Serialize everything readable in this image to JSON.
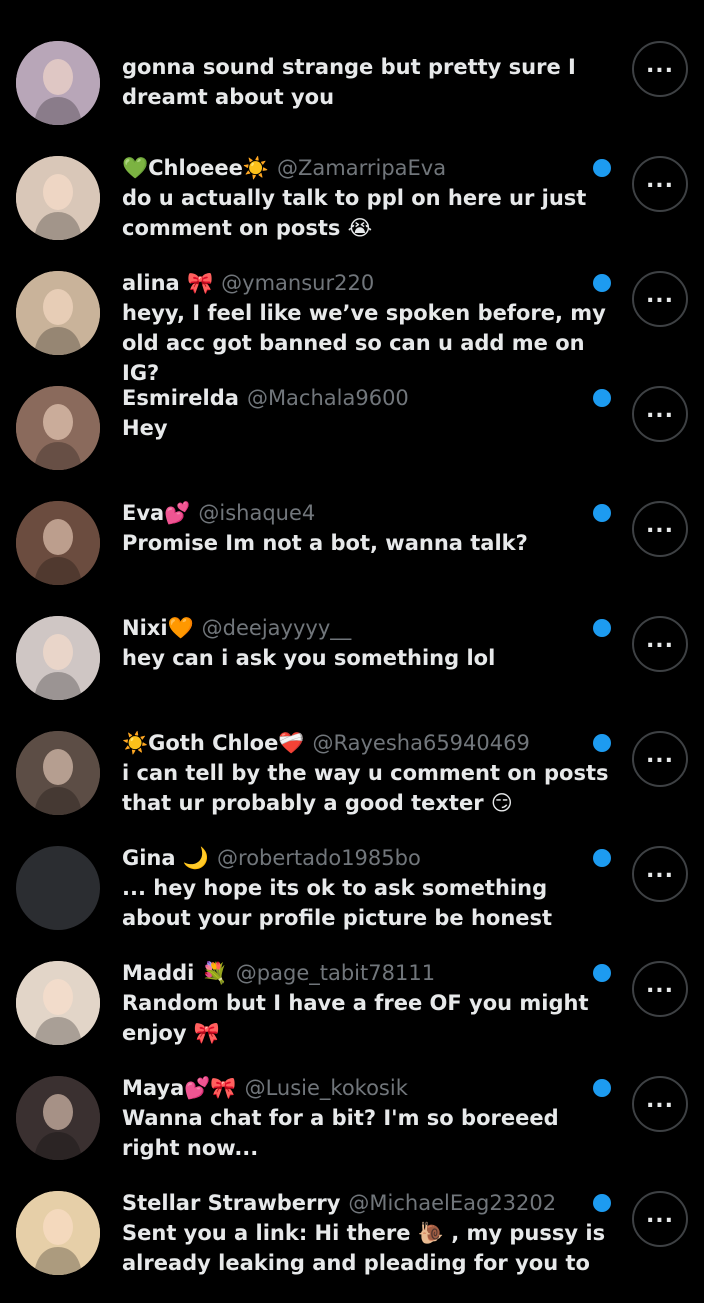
{
  "theme": {
    "background": "#000000",
    "text": "#e7e9ea",
    "secondary_text": "#71767b",
    "unread_dot": "#1d9bf0",
    "more_button_border": "#3e4144"
  },
  "conversations": [
    {
      "name": "",
      "handle": "",
      "message": "gonna sound strange but pretty sure I dreamt about you",
      "avatar_color": "#b8a6b8",
      "avatar_type": "photo",
      "more_icon": "more-horizontal-icon"
    },
    {
      "name": "💚Chloeee☀️",
      "handle": "@ZamarripaEva",
      "message": "do u actually talk to ppl on here ur just comment on posts 😭",
      "avatar_color": "#d9c7b8",
      "avatar_type": "photo",
      "more_icon": "more-horizontal-icon"
    },
    {
      "name": "alina 🎀",
      "handle": "@ymansur220",
      "message": "heyy, I feel like we’ve spoken before, my old acc got banned so can u add me on IG?",
      "avatar_color": "#c9b39a",
      "avatar_type": "photo",
      "more_icon": "more-horizontal-icon"
    },
    {
      "name": "Esmirelda",
      "handle": "@Machala9600",
      "message": "Hey",
      "avatar_color": "#8a6a5c",
      "avatar_type": "photo",
      "more_icon": "more-horizontal-icon"
    },
    {
      "name": "Eva💕",
      "handle": "@ishaque4",
      "message": "Promise Im not a bot, wanna talk?",
      "avatar_color": "#6b4c3f",
      "avatar_type": "photo",
      "more_icon": "more-horizontal-icon"
    },
    {
      "name": "Nixi🧡",
      "handle": "@deejayyyy__",
      "message": "hey can i ask you something lol",
      "avatar_color": "#cfc6c4",
      "avatar_type": "photo",
      "more_icon": "more-horizontal-icon"
    },
    {
      "name": "☀️Goth Chloe❤️‍🩹",
      "handle": "@Rayesha65940469",
      "message": "i can tell by the way u comment on posts that ur probably a good texter 😏",
      "avatar_color": "#5c4d45",
      "avatar_type": "photo",
      "more_icon": "more-horizontal-icon"
    },
    {
      "name": "Gina 🌙",
      "handle": "@robertado1985bo",
      "message": "... hey hope its ok to ask something about your profile picture be honest",
      "avatar_color": "#2b2d31",
      "avatar_type": "blank",
      "more_icon": "more-horizontal-icon"
    },
    {
      "name": "Maddi 💐",
      "handle": "@page_tabit78111",
      "message": "Random but I have a free OF you might enjoy 🎀",
      "avatar_color": "#e2d5c8",
      "avatar_type": "photo",
      "more_icon": "more-horizontal-icon"
    },
    {
      "name": "Maya💕🎀",
      "handle": "@Lusie_kokosik",
      "message": "Wanna chat for a bit? I'm so boreeed right now...",
      "avatar_color": "#3a3030",
      "avatar_type": "photo",
      "more_icon": "more-horizontal-icon"
    },
    {
      "name": "Stellar Strawberry",
      "handle": "@MichaelEag23202",
      "message": "Sent you a link: Hi there 🐌 , my pussy is already leaking and pleading for you to",
      "avatar_color": "#e6cfa8",
      "avatar_type": "photo",
      "more_icon": "more-horizontal-icon"
    }
  ]
}
